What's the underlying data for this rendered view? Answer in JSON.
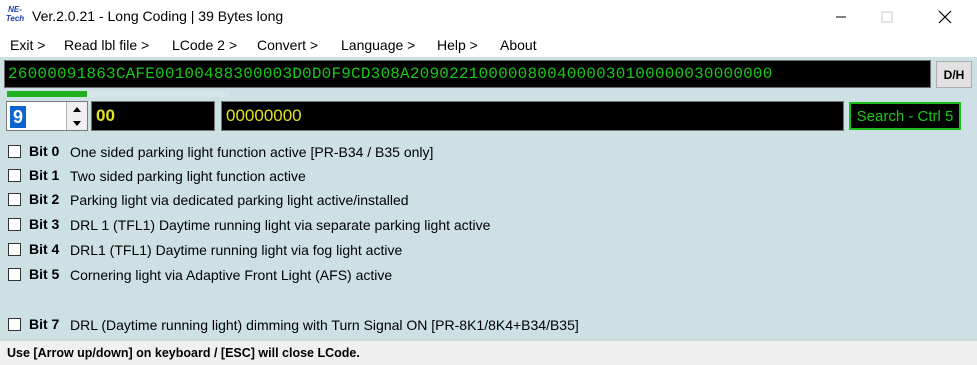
{
  "window": {
    "logo_text": "NE-Tech",
    "title": "Ver.2.0.21 - Long Coding | 39 Bytes long"
  },
  "menu": [
    {
      "label": "Exit >"
    },
    {
      "label": "Read lbl file >"
    },
    {
      "label": "LCode 2 >"
    },
    {
      "label": "Convert >"
    },
    {
      "label": "Language >"
    },
    {
      "label": "Help >"
    },
    {
      "label": "About"
    }
  ],
  "coding": {
    "hex": "26000091863CAFE00100488300003D0D0F9CD308A2090221000008004000030100000030000000",
    "dh_label": "D/H",
    "progress": 0.36
  },
  "selector": {
    "byte_index": "9",
    "byte_value": "00",
    "bits_value": "00000000",
    "search_label": "Search - Ctrl 5"
  },
  "bits": [
    {
      "label": "Bit 0",
      "desc": "One sided parking light function active [PR-B34 / B35 only]",
      "checked": false
    },
    {
      "label": "Bit 1",
      "desc": "Two sided parking light function active",
      "checked": false
    },
    {
      "label": "Bit 2",
      "desc": "Parking light via dedicated parking light active/installed",
      "checked": false
    },
    {
      "label": "Bit 3",
      "desc": "DRL 1 (TFL1) Daytime running light via separate parking light active",
      "checked": false
    },
    {
      "label": "Bit 4",
      "desc": "DRL1 (TFL1) Daytime running light via fog light active",
      "checked": false
    },
    {
      "label": "Bit 5",
      "desc": "Cornering light via Adaptive Front Light (AFS) active",
      "checked": false
    },
    {
      "label": "Bit 7",
      "desc": "DRL (Daytime running light) dimming with Turn Signal ON [PR-8K1/8K4+B34/B35]",
      "checked": false
    }
  ],
  "status": {
    "text": "Use [Arrow up/down] on keyboard / [ESC] will close LCode."
  },
  "colors": {
    "panel_bg": "#cde0e4",
    "hex_text": "#18c818",
    "byte_text": "#e3e31c",
    "selected_bg": "#0a64d2"
  }
}
